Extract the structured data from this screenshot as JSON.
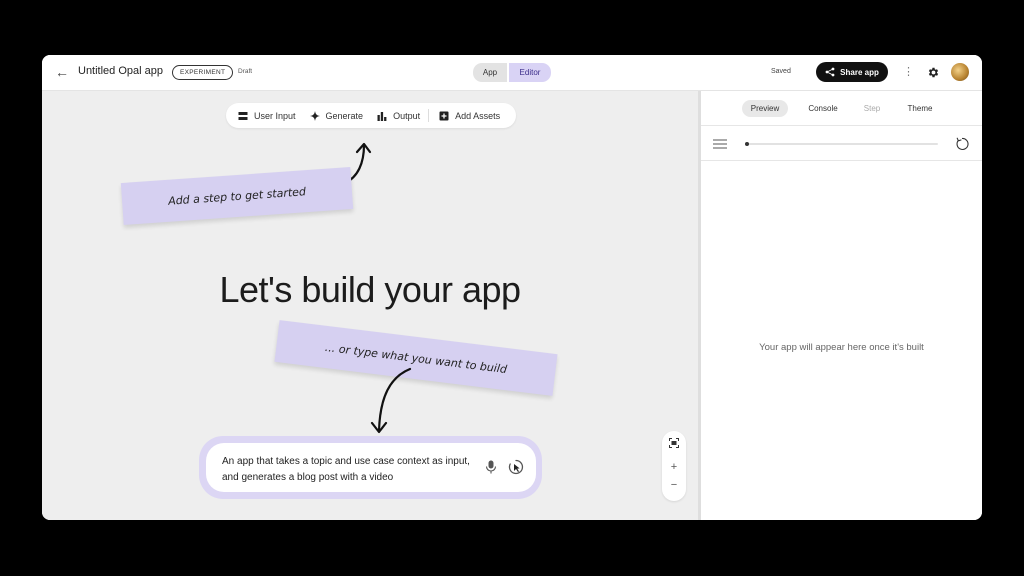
{
  "header": {
    "back_icon": "arrow-left-icon",
    "title": "Untitled Opal app",
    "badge": "EXPERIMENT",
    "status": "Draft",
    "mode_toggle": {
      "app_label": "App",
      "editor_label": "Editor",
      "selected": "Editor"
    },
    "save_status": "Saved",
    "share_label": "Share app",
    "share_icon": "share-icon",
    "more_icon": "more-vertical-icon",
    "settings_icon": "gear-icon",
    "avatar_icon": "avatar"
  },
  "toolbar": {
    "items": [
      {
        "label": "User Input",
        "icon": "user-input-icon"
      },
      {
        "label": "Generate",
        "icon": "sparkle-icon"
      },
      {
        "label": "Output",
        "icon": "output-chart-icon"
      },
      {
        "label": "Add Assets",
        "icon": "add-box-icon"
      }
    ]
  },
  "canvas": {
    "note_step": "Add a step to get started",
    "heading": "Let's build your app",
    "note_type": "... or type what you want to build",
    "prompt_text": "An app that takes a topic and use case context as input, and generates a blog post with a video",
    "zoom": {
      "fit_icon": "fit-screen-icon",
      "zoom_in": "+",
      "zoom_out": "−"
    }
  },
  "preview_panel": {
    "tabs": [
      {
        "label": "Preview",
        "state": "active"
      },
      {
        "label": "Console",
        "state": "normal"
      },
      {
        "label": "Step",
        "state": "disabled"
      },
      {
        "label": "Theme",
        "state": "normal"
      }
    ],
    "progress": 0.02,
    "empty_message": "Your app will appear here once it's built"
  },
  "colors": {
    "note_bg": "#d6d0f1",
    "editor_toggle_bg": "#d9d3f5",
    "canvas_bg": "#eeeeee",
    "share_bg": "#111111"
  }
}
